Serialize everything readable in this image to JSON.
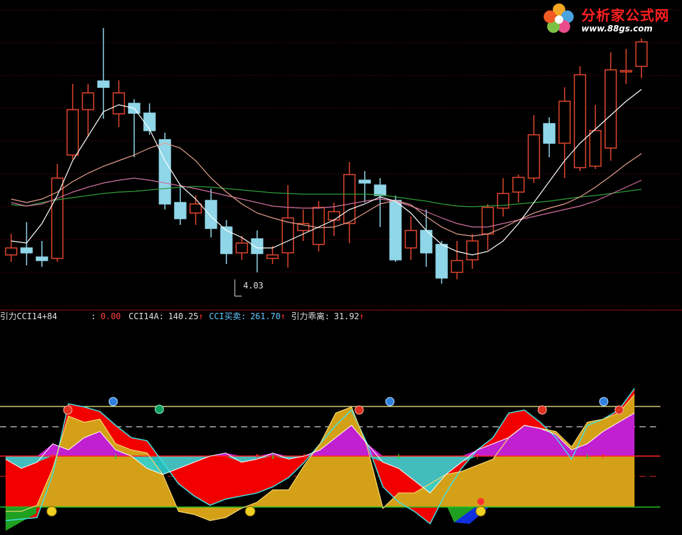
{
  "logo": {
    "title": "分析家公式网",
    "url": "www.88gs.com",
    "icon": "flower-icon"
  },
  "indicator_bar": {
    "formula_name": "引力CCI14+84",
    "value0_sep": ":",
    "value0": "0.00",
    "cci14a_label": "CCI14A:",
    "cci14a_value": "140.25",
    "cci_buysell_label": "CCI买卖:",
    "cci_buysell_value": "261.70",
    "divergence_label": "引力乖离:",
    "divergence_value": "31.92",
    "up_arrow": "↑"
  },
  "colors": {
    "up_candle": "#e0452c",
    "down_candle": "#8fd6e8",
    "ma_white": "#ffffff",
    "ma_pink": "#e4a090",
    "ma_magenta": "#d070a0",
    "ma_green": "#2f9e3a",
    "grid_red": "#7a1212",
    "fill_gold": "#d4a017",
    "fill_red": "#ff0000",
    "fill_magenta": "#c020d0",
    "fill_cyan": "#30d0d0",
    "fill_green": "#20a020",
    "fill_blue": "#1030e0",
    "line_cyan": "#40e0e0",
    "line_white": "#ffffff"
  },
  "chart_data": [
    {
      "type": "candlestick",
      "low_label": "4.03",
      "candles": [
        [
          365,
          355,
          335,
          375
        ],
        [
          355,
          362,
          318,
          380
        ],
        [
          368,
          373,
          345,
          382
        ],
        [
          370,
          255,
          235,
          375
        ],
        [
          222,
          157,
          120,
          228
        ],
        [
          157,
          133,
          120,
          195
        ],
        [
          116,
          125,
          40,
          170
        ],
        [
          163,
          133,
          115,
          182
        ],
        [
          148,
          162,
          142,
          225
        ],
        [
          162,
          187,
          148,
          193
        ],
        [
          200,
          292,
          190,
          300
        ],
        [
          290,
          313,
          265,
          322
        ],
        [
          305,
          292,
          280,
          322
        ],
        [
          287,
          327,
          270,
          340
        ],
        [
          325,
          363,
          315,
          378
        ],
        [
          362,
          348,
          338,
          372
        ],
        [
          342,
          363,
          330,
          390
        ],
        [
          370,
          365,
          352,
          378
        ],
        [
          362,
          312,
          265,
          383
        ],
        [
          330,
          320,
          300,
          345
        ],
        [
          350,
          297,
          288,
          360
        ],
        [
          315,
          303,
          290,
          338
        ],
        [
          320,
          250,
          232,
          348
        ],
        [
          258,
          262,
          245,
          290
        ],
        [
          265,
          280,
          255,
          325
        ],
        [
          287,
          372,
          280,
          375
        ],
        [
          355,
          330,
          310,
          372
        ],
        [
          330,
          362,
          300,
          382
        ],
        [
          350,
          398,
          345,
          406
        ],
        [
          390,
          373,
          345,
          400
        ],
        [
          372,
          345,
          335,
          385
        ],
        [
          335,
          297,
          292,
          358
        ],
        [
          298,
          277,
          255,
          310
        ],
        [
          275,
          254,
          250,
          290
        ],
        [
          255,
          193,
          165,
          262
        ],
        [
          177,
          205,
          168,
          225
        ],
        [
          205,
          145,
          125,
          255
        ],
        [
          240,
          107,
          95,
          245
        ],
        [
          238,
          187,
          150,
          242
        ],
        [
          212,
          100,
          75,
          230
        ],
        [
          103,
          101,
          70,
          120
        ],
        [
          95,
          60,
          55,
          112
        ]
      ],
      "ma_white": [
        345,
        348,
        320,
        280,
        230,
        195,
        160,
        150,
        155,
        185,
        230,
        265,
        285,
        310,
        330,
        340,
        355,
        355,
        345,
        335,
        325,
        315,
        300,
        292,
        282,
        288,
        305,
        330,
        350,
        360,
        365,
        360,
        345,
        320,
        290,
        260,
        230,
        205,
        185,
        165,
        145,
        128
      ],
      "ma_pink": [
        285,
        290,
        285,
        275,
        260,
        248,
        238,
        230,
        222,
        212,
        205,
        212,
        230,
        255,
        275,
        292,
        305,
        312,
        318,
        322,
        326,
        325,
        318,
        305,
        292,
        287,
        293,
        310,
        325,
        335,
        338,
        335,
        326,
        315,
        305,
        298,
        292,
        282,
        268,
        252,
        235,
        220
      ],
      "ma_magenta": [
        290,
        295,
        292,
        284,
        275,
        268,
        262,
        258,
        255,
        258,
        262,
        266,
        270,
        275,
        280,
        285,
        290,
        295,
        297,
        298,
        298,
        296,
        292,
        288,
        285,
        288,
        295,
        303,
        312,
        320,
        325,
        325,
        320,
        315,
        310,
        305,
        300,
        295,
        288,
        278,
        268,
        258
      ],
      "ma_green": [
        293,
        295,
        290,
        286,
        283,
        280,
        277,
        275,
        274,
        272,
        270,
        268,
        267,
        268,
        270,
        272,
        274,
        276,
        277,
        278,
        278,
        278,
        278,
        278,
        279,
        282,
        285,
        288,
        292,
        295,
        296,
        295,
        294,
        292,
        290,
        288,
        285,
        282,
        280,
        277,
        274,
        271
      ]
    },
    {
      "type": "area",
      "x": [
        0,
        1,
        2,
        3,
        4,
        5,
        6,
        7,
        8,
        9,
        10,
        11,
        12,
        13,
        14,
        15,
        16,
        17,
        18,
        19,
        20,
        21,
        22,
        23,
        24,
        25,
        26,
        27,
        28,
        29,
        30,
        31,
        32,
        33,
        34,
        35,
        36,
        37,
        38,
        39,
        40,
        41,
        42
      ],
      "series": [
        {
          "name": "CCI买卖",
          "values": [
            -180,
            -180,
            -160,
            -40,
            130,
            110,
            120,
            40,
            20,
            10,
            -60,
            -180,
            -190,
            -210,
            -200,
            -170,
            -150,
            -110,
            -110,
            -30,
            40,
            140,
            160,
            30,
            -170,
            -120,
            -120,
            -90,
            -60,
            -50,
            -30,
            -10,
            60,
            100,
            90,
            80,
            30,
            110,
            120,
            140,
            200
          ]
        },
        {
          "name": "引力乖离",
          "values": [
            -10,
            -40,
            -20,
            40,
            20,
            60,
            80,
            20,
            0,
            -40,
            -60,
            -40,
            -20,
            0,
            10,
            -20,
            -10,
            10,
            -10,
            0,
            20,
            60,
            100,
            40,
            -20,
            -40,
            -80,
            -120,
            -60,
            -20,
            20,
            40,
            60,
            100,
            90,
            70,
            20,
            40,
            80,
            110,
            140
          ]
        },
        {
          "name": "CCI14A",
          "values": [
            -210,
            -205,
            -200,
            -60,
            170,
            160,
            145,
            100,
            60,
            50,
            -20,
            -90,
            -130,
            -160,
            -140,
            -130,
            -120,
            -100,
            -70,
            -20,
            40,
            100,
            150,
            40,
            -100,
            -150,
            -180,
            -220,
            -120,
            -40,
            20,
            60,
            140,
            150,
            110,
            60,
            -10,
            100,
            120,
            150,
            220
          ]
        }
      ],
      "reference_lines": [
        100,
        40,
        -100
      ]
    }
  ]
}
